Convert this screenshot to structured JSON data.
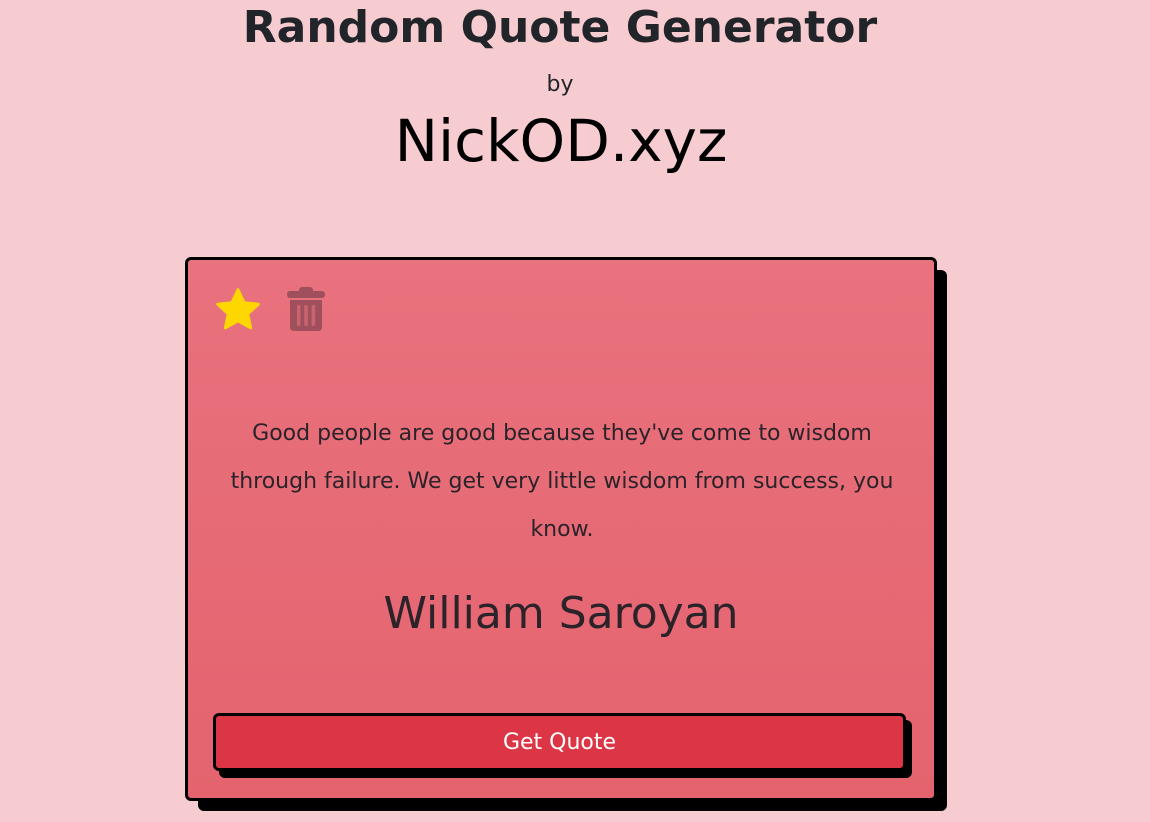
{
  "header": {
    "title": "Random Quote Generator",
    "by": "by",
    "site": "NickOD.xyz"
  },
  "quote": {
    "text": "Good people are good because they've come to wisdom through failure. We get very little wisdom from success, you know.",
    "author": "William Saroyan"
  },
  "actions": {
    "favorite_icon": "star-icon",
    "delete_icon": "trash-icon",
    "get_quote_label": "Get Quote"
  },
  "colors": {
    "background": "#f6ccd1",
    "card": "#e4636e",
    "button": "#dc3545",
    "star": "#ffd700",
    "trash": "#a0505c"
  }
}
